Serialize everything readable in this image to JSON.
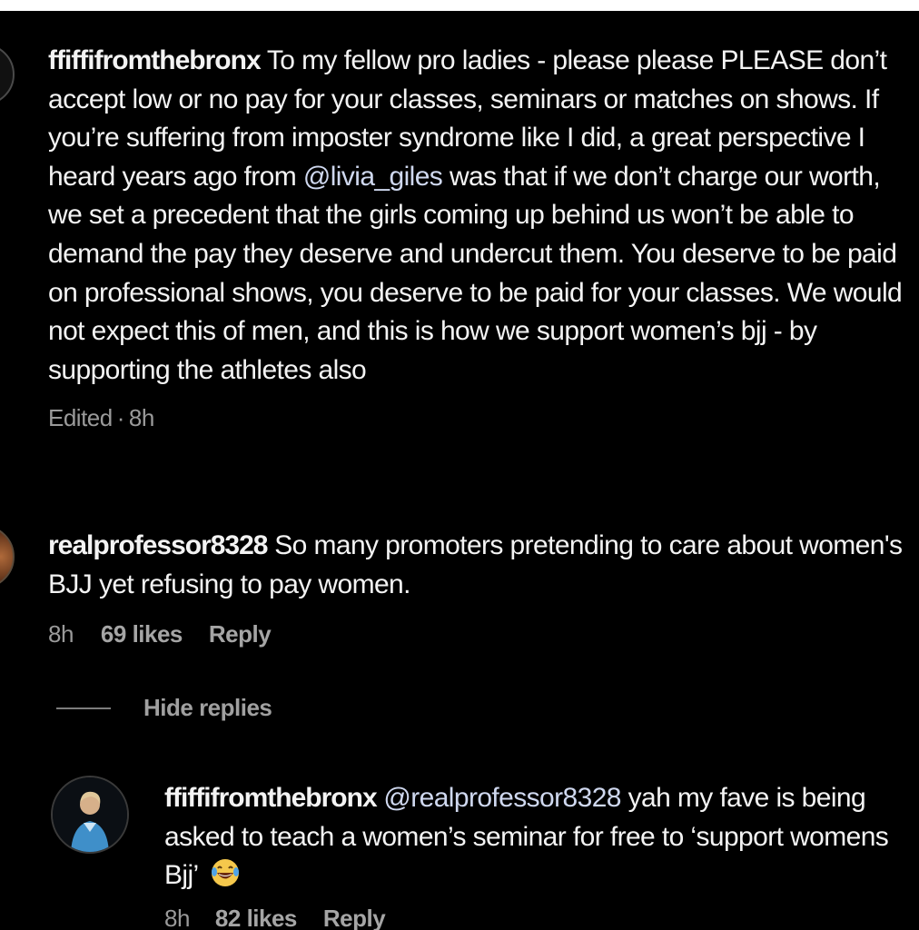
{
  "comments": [
    {
      "username": "ffiffifromthebronx",
      "text_before_mention": "To my fellow pro ladies - please please PLEASE don’t accept low or no pay for your classes, seminars or matches on shows. If you’re suffering from imposter syndrome like I did, a great perspective I heard years ago from ",
      "mention": "@livia_giles",
      "text_after_mention": " was that if we don’t charge our worth, we set a precedent that the girls coming up behind us won’t be able to demand the pay they deserve and undercut them. You deserve to be paid on professional shows, you deserve to be paid for your classes. We would not expect this of men, and this is how we support women’s bjj - by supporting the athletes also",
      "edited_label": "Edited",
      "time": "8h"
    },
    {
      "username": "realprofessor8328",
      "text": "So many promoters pretending to care about women's BJJ yet refusing to pay women.",
      "time": "8h",
      "likes": "69 likes",
      "reply_label": "Reply"
    }
  ],
  "hide_replies_label": "Hide replies",
  "reply": {
    "username": "ffiffifromthebronx",
    "mention": "@realprofessor8328",
    "text": " yah my fave is being asked to teach a women’s seminar for free to ‘support womens Bjj’",
    "emoji": "laughing-tears-emoji",
    "time": "8h",
    "likes": "82 likes",
    "reply_label": "Reply"
  },
  "colors": {
    "background": "#000000",
    "text": "#f3f3f3",
    "muted": "#9a9a9a",
    "mention": "#cfd8ef"
  }
}
